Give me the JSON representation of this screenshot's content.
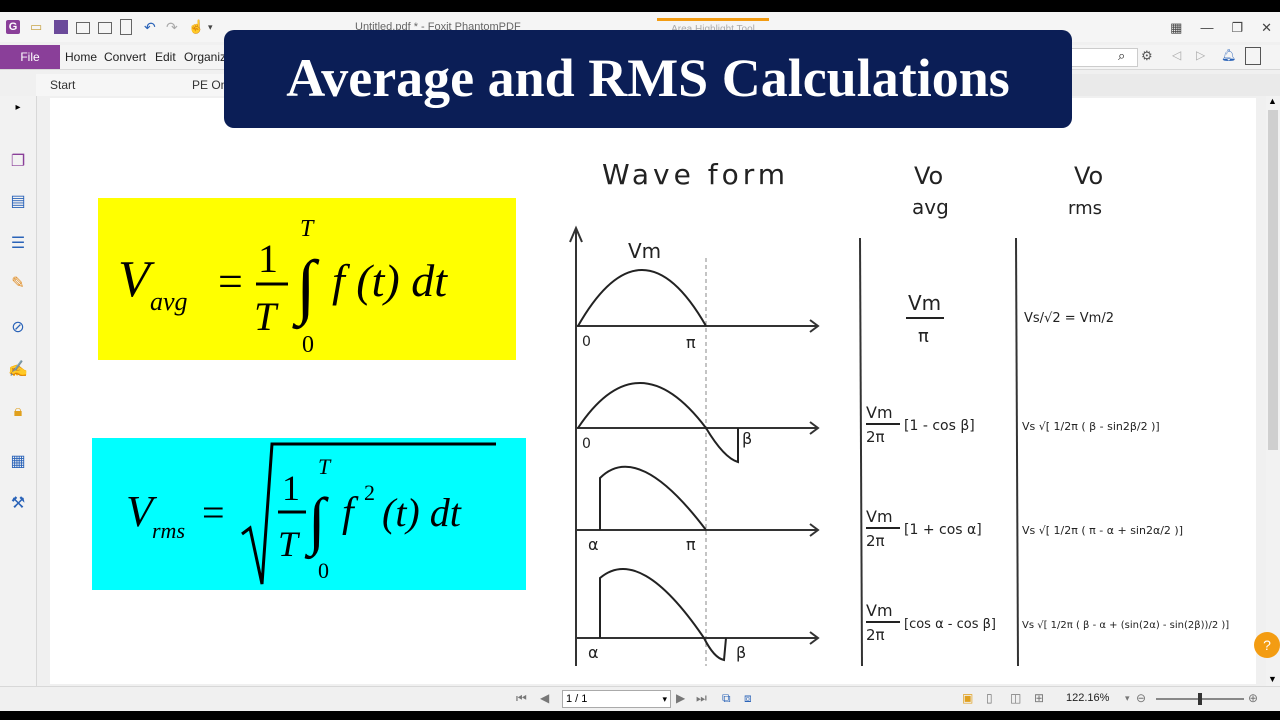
{
  "app": {
    "document_title": "Untitled.pdf * - Foxit PhantomPDF",
    "tool_title": "Area Highlight Tool"
  },
  "ribbon": {
    "file_label": "File",
    "menus": [
      "Home",
      "Convert",
      "Edit",
      "Organize"
    ]
  },
  "tabs": [
    {
      "label": "Start"
    },
    {
      "label": "PE On"
    }
  ],
  "banner": {
    "title": "Average and RMS Calculations"
  },
  "formulas": {
    "avg": {
      "lhs_main": "V",
      "lhs_sub": "avg",
      "num": "1",
      "den": "T",
      "upper": "T",
      "lower": "0",
      "body": "f (t)  dt",
      "bg": "#ffff00"
    },
    "rms": {
      "lhs_main": "V",
      "lhs_sub": "rms",
      "num": "1",
      "den": "T",
      "upper": "T",
      "lower": "0",
      "body_f": "f",
      "body_exp": "2",
      "body_rest": "(t)  dt",
      "bg": "#00ffff"
    }
  },
  "table": {
    "headers": {
      "waveform": "Wave form",
      "avg": [
        "Vo",
        "avg"
      ],
      "rms": [
        "Vo",
        "rms"
      ]
    },
    "wave_labels": {
      "vm": "Vm",
      "zero": "0",
      "pi": "π",
      "beta": "β",
      "alpha": "α"
    },
    "rows": [
      {
        "avg": {
          "num": "Vm",
          "den": "π",
          "rest": ""
        },
        "rms": {
          "text": "Vs/√2 = Vm/2"
        }
      },
      {
        "avg": {
          "num": "Vm",
          "den": "2π",
          "rest": "[1 - cos β]"
        },
        "rms": {
          "text": "Vs √[ 1/2π ( β - sin2β/2 )]"
        }
      },
      {
        "avg": {
          "num": "Vm",
          "den": "2π",
          "rest": "[1 + cos α]"
        },
        "rms": {
          "text": "Vs √[ 1/2π ( π - α + sin2α/2 )]"
        }
      },
      {
        "avg": {
          "num": "Vm",
          "den": "2π",
          "rest": "[cos α - cos β]"
        },
        "rms": {
          "text": "Vs √[ 1/2π ( β - α + (sin(2α) - sin(2β))/2 )]"
        }
      }
    ]
  },
  "status": {
    "page": "1 / 1",
    "zoom": "122.16%"
  },
  "colors": {
    "accent": "#8a3f99",
    "banner": "#0b1e56"
  }
}
